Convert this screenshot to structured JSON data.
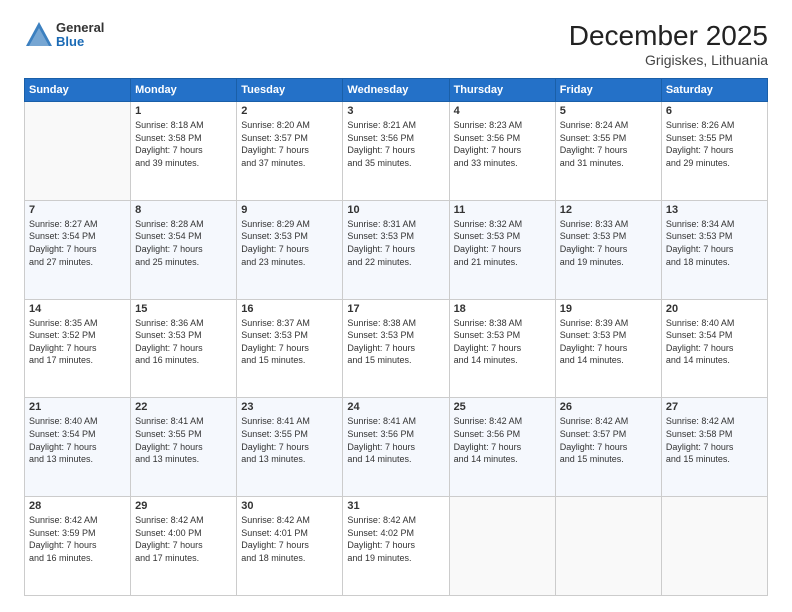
{
  "logo": {
    "general": "General",
    "blue": "Blue"
  },
  "title": "December 2025",
  "location": "Grigiskes, Lithuania",
  "days_header": [
    "Sunday",
    "Monday",
    "Tuesday",
    "Wednesday",
    "Thursday",
    "Friday",
    "Saturday"
  ],
  "weeks": [
    [
      {
        "day": "",
        "info": ""
      },
      {
        "day": "1",
        "info": "Sunrise: 8:18 AM\nSunset: 3:58 PM\nDaylight: 7 hours\nand 39 minutes."
      },
      {
        "day": "2",
        "info": "Sunrise: 8:20 AM\nSunset: 3:57 PM\nDaylight: 7 hours\nand 37 minutes."
      },
      {
        "day": "3",
        "info": "Sunrise: 8:21 AM\nSunset: 3:56 PM\nDaylight: 7 hours\nand 35 minutes."
      },
      {
        "day": "4",
        "info": "Sunrise: 8:23 AM\nSunset: 3:56 PM\nDaylight: 7 hours\nand 33 minutes."
      },
      {
        "day": "5",
        "info": "Sunrise: 8:24 AM\nSunset: 3:55 PM\nDaylight: 7 hours\nand 31 minutes."
      },
      {
        "day": "6",
        "info": "Sunrise: 8:26 AM\nSunset: 3:55 PM\nDaylight: 7 hours\nand 29 minutes."
      }
    ],
    [
      {
        "day": "7",
        "info": "Sunrise: 8:27 AM\nSunset: 3:54 PM\nDaylight: 7 hours\nand 27 minutes."
      },
      {
        "day": "8",
        "info": "Sunrise: 8:28 AM\nSunset: 3:54 PM\nDaylight: 7 hours\nand 25 minutes."
      },
      {
        "day": "9",
        "info": "Sunrise: 8:29 AM\nSunset: 3:53 PM\nDaylight: 7 hours\nand 23 minutes."
      },
      {
        "day": "10",
        "info": "Sunrise: 8:31 AM\nSunset: 3:53 PM\nDaylight: 7 hours\nand 22 minutes."
      },
      {
        "day": "11",
        "info": "Sunrise: 8:32 AM\nSunset: 3:53 PM\nDaylight: 7 hours\nand 21 minutes."
      },
      {
        "day": "12",
        "info": "Sunrise: 8:33 AM\nSunset: 3:53 PM\nDaylight: 7 hours\nand 19 minutes."
      },
      {
        "day": "13",
        "info": "Sunrise: 8:34 AM\nSunset: 3:53 PM\nDaylight: 7 hours\nand 18 minutes."
      }
    ],
    [
      {
        "day": "14",
        "info": "Sunrise: 8:35 AM\nSunset: 3:52 PM\nDaylight: 7 hours\nand 17 minutes."
      },
      {
        "day": "15",
        "info": "Sunrise: 8:36 AM\nSunset: 3:53 PM\nDaylight: 7 hours\nand 16 minutes."
      },
      {
        "day": "16",
        "info": "Sunrise: 8:37 AM\nSunset: 3:53 PM\nDaylight: 7 hours\nand 15 minutes."
      },
      {
        "day": "17",
        "info": "Sunrise: 8:38 AM\nSunset: 3:53 PM\nDaylight: 7 hours\nand 15 minutes."
      },
      {
        "day": "18",
        "info": "Sunrise: 8:38 AM\nSunset: 3:53 PM\nDaylight: 7 hours\nand 14 minutes."
      },
      {
        "day": "19",
        "info": "Sunrise: 8:39 AM\nSunset: 3:53 PM\nDaylight: 7 hours\nand 14 minutes."
      },
      {
        "day": "20",
        "info": "Sunrise: 8:40 AM\nSunset: 3:54 PM\nDaylight: 7 hours\nand 14 minutes."
      }
    ],
    [
      {
        "day": "21",
        "info": "Sunrise: 8:40 AM\nSunset: 3:54 PM\nDaylight: 7 hours\nand 13 minutes."
      },
      {
        "day": "22",
        "info": "Sunrise: 8:41 AM\nSunset: 3:55 PM\nDaylight: 7 hours\nand 13 minutes."
      },
      {
        "day": "23",
        "info": "Sunrise: 8:41 AM\nSunset: 3:55 PM\nDaylight: 7 hours\nand 13 minutes."
      },
      {
        "day": "24",
        "info": "Sunrise: 8:41 AM\nSunset: 3:56 PM\nDaylight: 7 hours\nand 14 minutes."
      },
      {
        "day": "25",
        "info": "Sunrise: 8:42 AM\nSunset: 3:56 PM\nDaylight: 7 hours\nand 14 minutes."
      },
      {
        "day": "26",
        "info": "Sunrise: 8:42 AM\nSunset: 3:57 PM\nDaylight: 7 hours\nand 15 minutes."
      },
      {
        "day": "27",
        "info": "Sunrise: 8:42 AM\nSunset: 3:58 PM\nDaylight: 7 hours\nand 15 minutes."
      }
    ],
    [
      {
        "day": "28",
        "info": "Sunrise: 8:42 AM\nSunset: 3:59 PM\nDaylight: 7 hours\nand 16 minutes."
      },
      {
        "day": "29",
        "info": "Sunrise: 8:42 AM\nSunset: 4:00 PM\nDaylight: 7 hours\nand 17 minutes."
      },
      {
        "day": "30",
        "info": "Sunrise: 8:42 AM\nSunset: 4:01 PM\nDaylight: 7 hours\nand 18 minutes."
      },
      {
        "day": "31",
        "info": "Sunrise: 8:42 AM\nSunset: 4:02 PM\nDaylight: 7 hours\nand 19 minutes."
      },
      {
        "day": "",
        "info": ""
      },
      {
        "day": "",
        "info": ""
      },
      {
        "day": "",
        "info": ""
      }
    ]
  ]
}
